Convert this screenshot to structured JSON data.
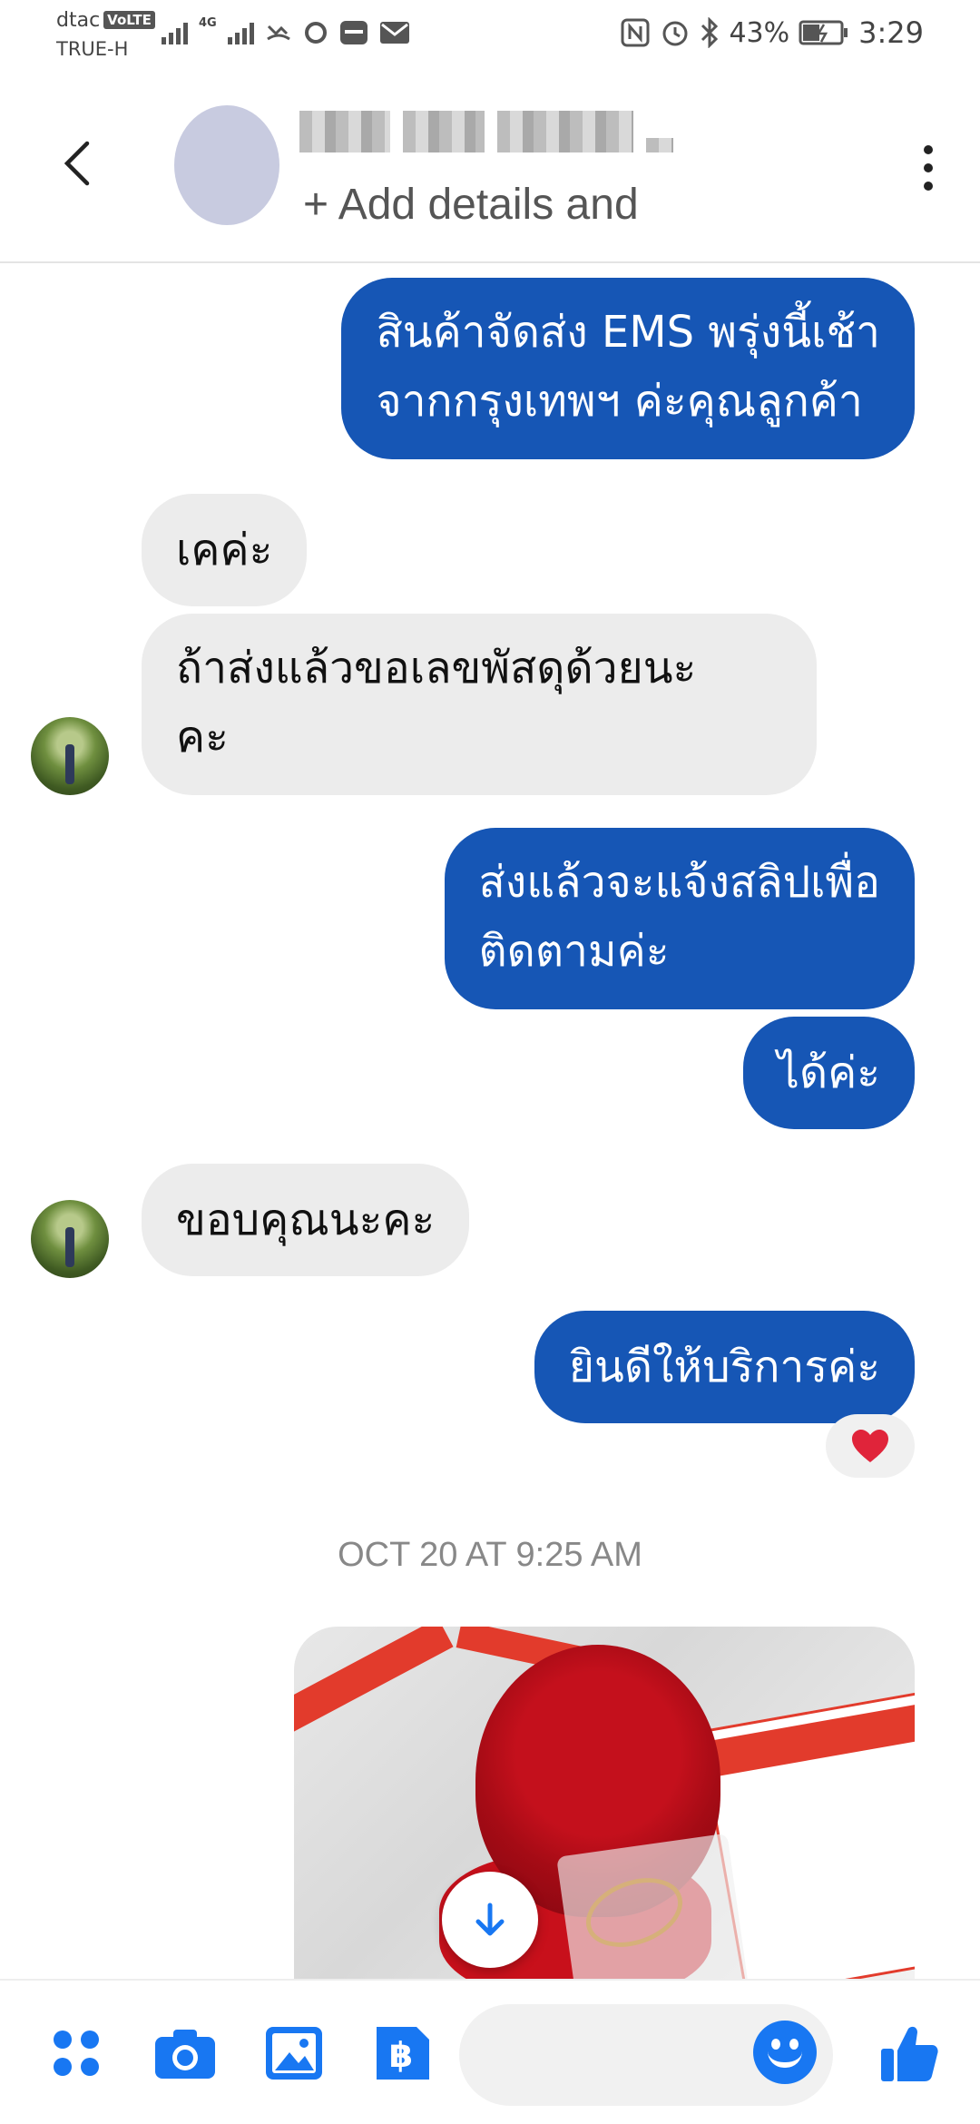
{
  "status_bar": {
    "carrier_primary": "dtac",
    "volte_badge": "VoLTE",
    "carrier_secondary": "TRUE-H",
    "network_type": "4G",
    "battery": "43%",
    "time": "3:29"
  },
  "header": {
    "subtitle": "+ Add details and"
  },
  "messages": [
    {
      "direction": "outgoing",
      "lines": [
        "สินค้าจัดส่ง EMS พรุ่งนี้เช้า",
        "จากกรุงเทพฯ ค่ะคุณลูกค้า"
      ]
    },
    {
      "direction": "incoming",
      "lines": [
        "เคค่ะ"
      ]
    },
    {
      "direction": "incoming",
      "lines": [
        "ถ้าส่งแล้วขอเลขพัสดุด้วยนะ",
        "คะ"
      ]
    },
    {
      "direction": "outgoing",
      "lines": [
        "ส่งแล้วจะแจ้งสลิปเพื่อ",
        "ติดตามค่ะ"
      ]
    },
    {
      "direction": "outgoing",
      "lines": [
        "ได้ค่ะ"
      ]
    },
    {
      "direction": "incoming",
      "lines": [
        "ขอบคุณนะคะ"
      ]
    },
    {
      "direction": "outgoing",
      "lines": [
        "ยินดีให้บริการค่ะ"
      ],
      "reaction": "heart"
    }
  ],
  "timestamp": "OCT 20 AT 9:25 AM",
  "colors": {
    "outgoing_bubble": "#1656b5",
    "incoming_bubble": "#ececec",
    "accent": "#1877f2"
  },
  "bottom_bar": {
    "icons": [
      "apps-icon",
      "camera-icon",
      "gallery-icon",
      "payment-baht-icon",
      "emoji-icon",
      "thumbs-up-icon"
    ]
  }
}
